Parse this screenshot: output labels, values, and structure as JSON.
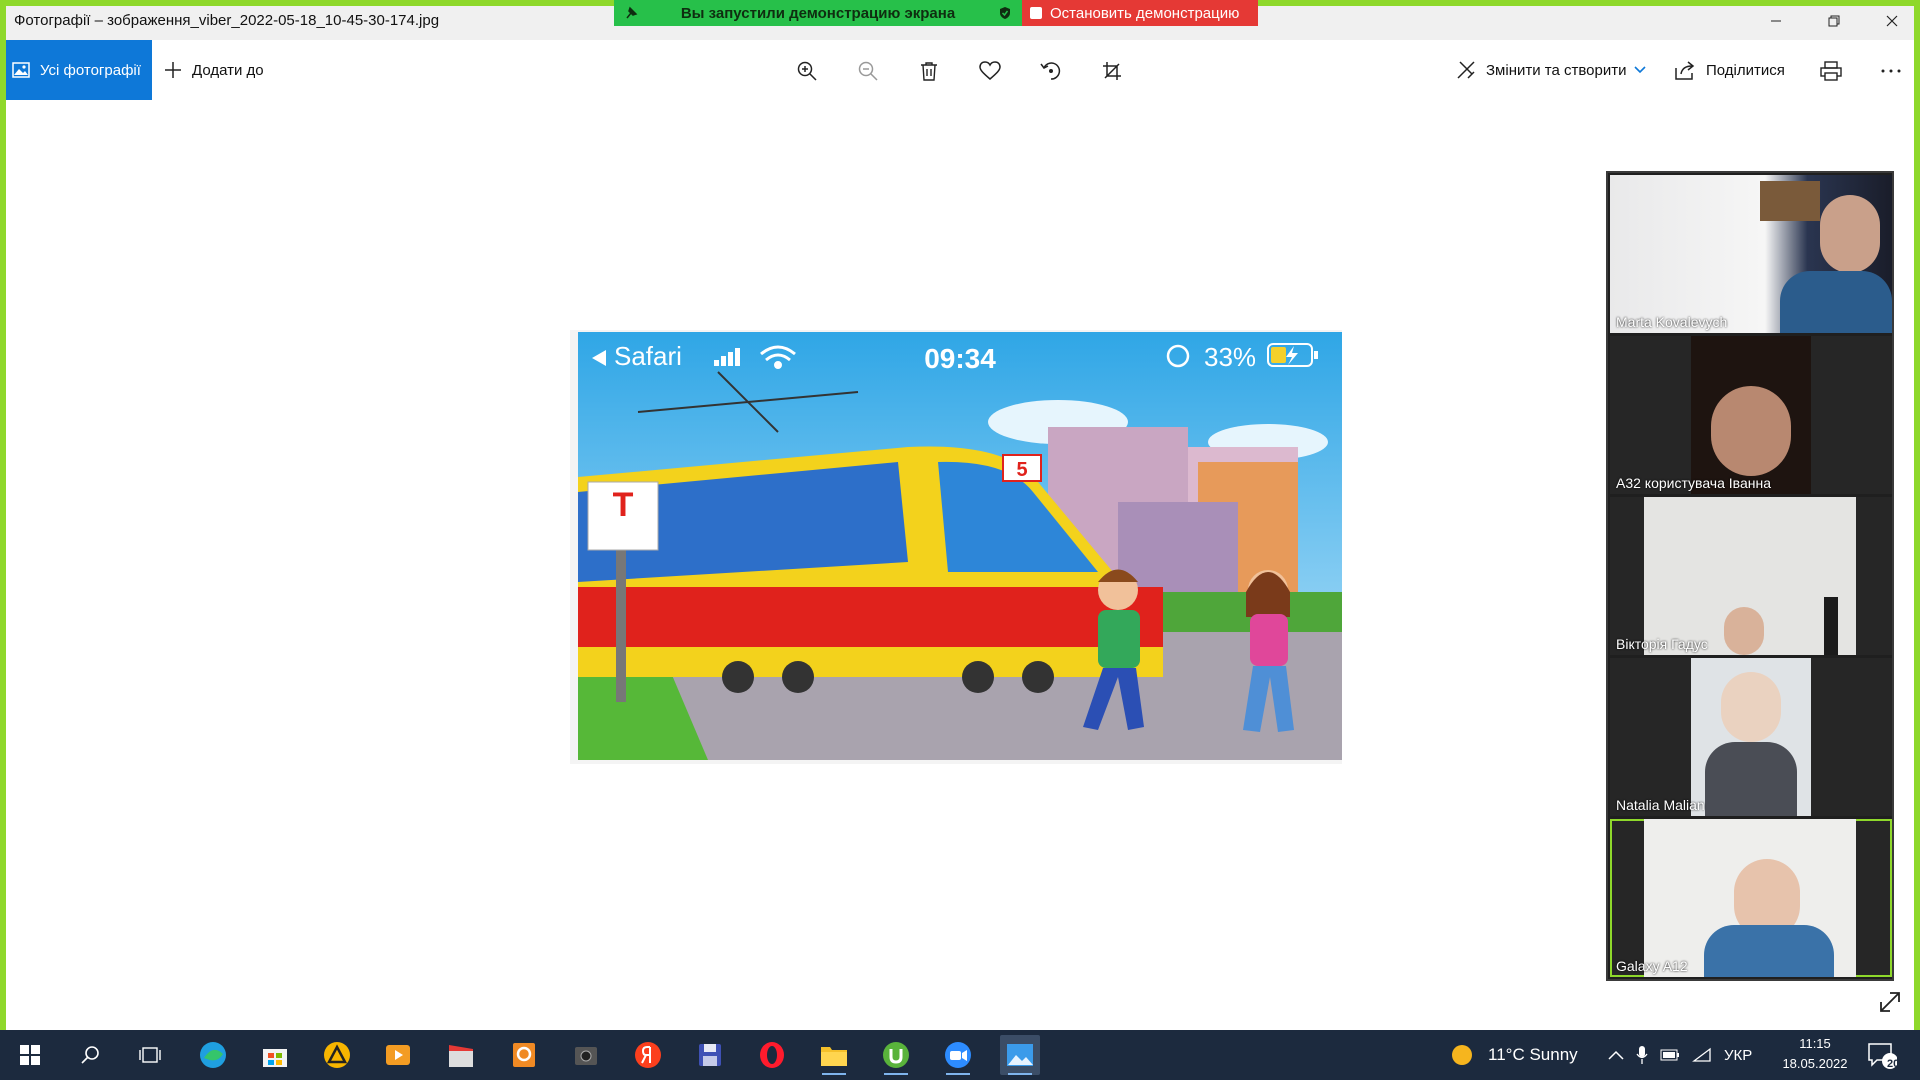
{
  "window": {
    "title": "Фотографії – зображення_viber_2022-05-18_10-45-30-174.jpg",
    "minimize_icon": "minimize-icon",
    "restore_icon": "restore-icon",
    "close_icon": "close-icon"
  },
  "share_banner": {
    "message": "Вы запустили демонстрацию экрана",
    "stop_label": "Остановить демонстрацию"
  },
  "toolbar": {
    "all_photos_label": "Усі фотографії",
    "add_to_label": "Додати до",
    "edit_create_label": "Змінити та створити",
    "share_label": "Поділитися",
    "tools": [
      "zoom-in-icon",
      "zoom-out-icon",
      "delete-icon",
      "favorite-icon",
      "rotate-icon",
      "crop-icon"
    ]
  },
  "photo": {
    "status_app": "Safari",
    "status_time": "09:34",
    "status_battery": "33%",
    "tram_number": "5",
    "stop_sign_letter": "T"
  },
  "participants": [
    {
      "name": "Marta Kovalevych"
    },
    {
      "name": "A32 користувача Іванна"
    },
    {
      "name": "Вікторія Гадус"
    },
    {
      "name": "Natalia Malian"
    },
    {
      "name": "Galaxy A12"
    }
  ],
  "taskbar": {
    "weather": "11°C Sunny",
    "language": "УКР",
    "time": "11:15",
    "date": "18.05.2022",
    "notifications": "20"
  },
  "colors": {
    "share_frame": "#8ed82b",
    "accent": "#0e78d8",
    "share_green": "#27c04a",
    "share_red": "#e53935",
    "taskbar": "#1c2a3e"
  }
}
